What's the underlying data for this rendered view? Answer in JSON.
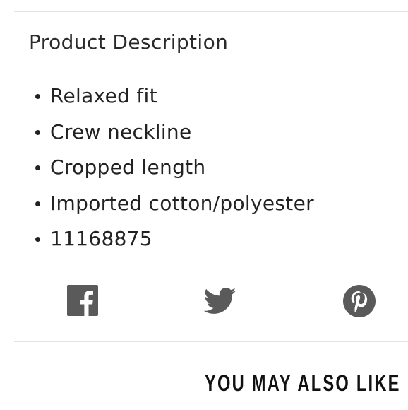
{
  "product_description": {
    "title": "Product Description",
    "bullets": [
      "Relaxed fit",
      "Crew neckline",
      "Cropped length",
      "Imported cotton/polyester",
      "11168875"
    ]
  },
  "share": {
    "icons": [
      "facebook-icon",
      "twitter-icon",
      "pinterest-icon"
    ],
    "icon_color": "#5a5a5a"
  },
  "recommendations": {
    "heading": "YOU MAY ALSO LIKE"
  },
  "colors": {
    "divider": "#e3e3e3",
    "text": "#222222"
  }
}
